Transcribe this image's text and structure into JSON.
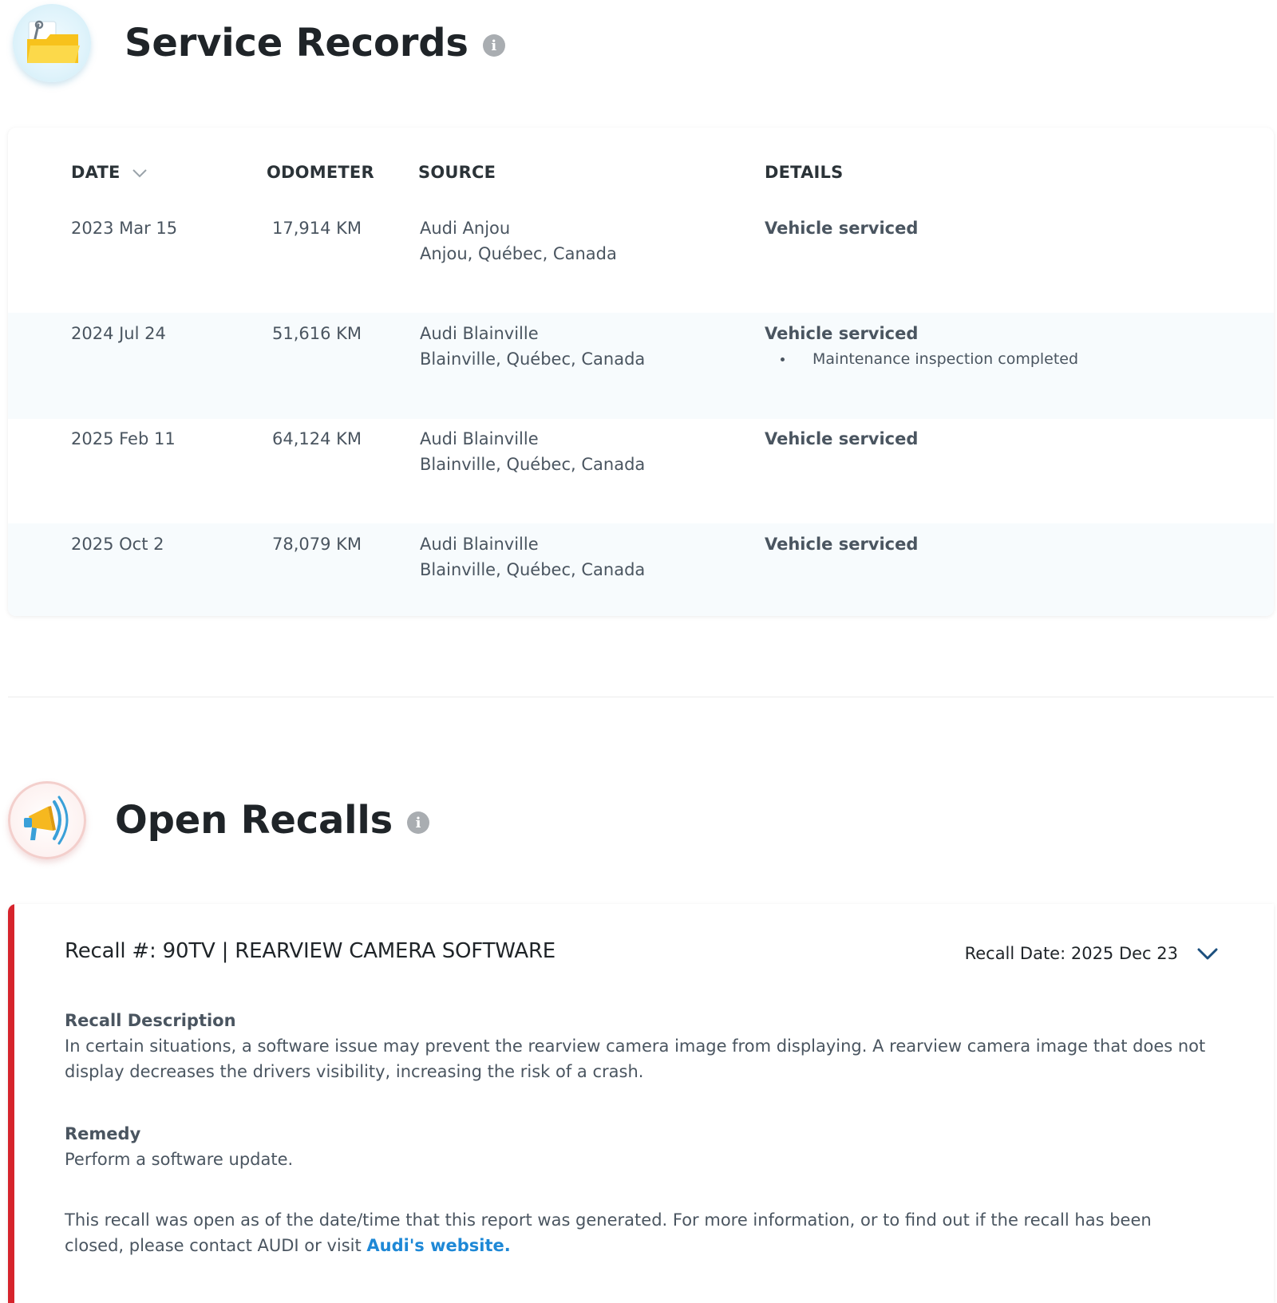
{
  "service_records": {
    "title": "Service Records",
    "info_icon": "info-icon",
    "badge_icon": "folder-wrench-icon",
    "columns": {
      "date": "DATE",
      "odometer": "ODOMETER",
      "source": "SOURCE",
      "details": "DETAILS"
    },
    "rows": [
      {
        "date": "2023 Mar 15",
        "odometer": "17,914 KM",
        "source_name": "Audi Anjou",
        "source_location": "Anjou, Québec, Canada",
        "detail_title": "Vehicle serviced",
        "detail_items": []
      },
      {
        "date": "2024 Jul 24",
        "odometer": "51,616 KM",
        "source_name": "Audi Blainville",
        "source_location": "Blainville, Québec, Canada",
        "detail_title": "Vehicle serviced",
        "detail_items": [
          "Maintenance inspection completed"
        ]
      },
      {
        "date": "2025 Feb 11",
        "odometer": "64,124 KM",
        "source_name": "Audi Blainville",
        "source_location": "Blainville, Québec, Canada",
        "detail_title": "Vehicle serviced",
        "detail_items": []
      },
      {
        "date": "2025 Oct 2",
        "odometer": "78,079 KM",
        "source_name": "Audi Blainville",
        "source_location": "Blainville, Québec, Canada",
        "detail_title": "Vehicle serviced",
        "detail_items": []
      }
    ]
  },
  "open_recalls": {
    "title": "Open Recalls",
    "info_icon": "info-icon",
    "badge_icon": "megaphone-icon",
    "recall": {
      "title": "Recall #: 90TV | REARVIEW CAMERA SOFTWARE",
      "date": "Recall Date: 2025 Dec 23",
      "description_label": "Recall Description",
      "description": "In certain situations, a software issue may prevent the rearview camera image from displaying. A rearview camera image that does not display decreases the drivers visibility, increasing the risk of a crash.",
      "remedy_label": "Remedy",
      "remedy": "Perform a software update.",
      "note": "This recall was open as of the date/time that this report was generated. For more information, or to find out if the recall has been closed, please contact AUDI or visit",
      "link_text": "Audi's website."
    }
  },
  "colors": {
    "recall_accent": "#d6242c",
    "link": "#1e88d6",
    "row_alt": "#f7fbfd",
    "text": "#4a5560"
  }
}
